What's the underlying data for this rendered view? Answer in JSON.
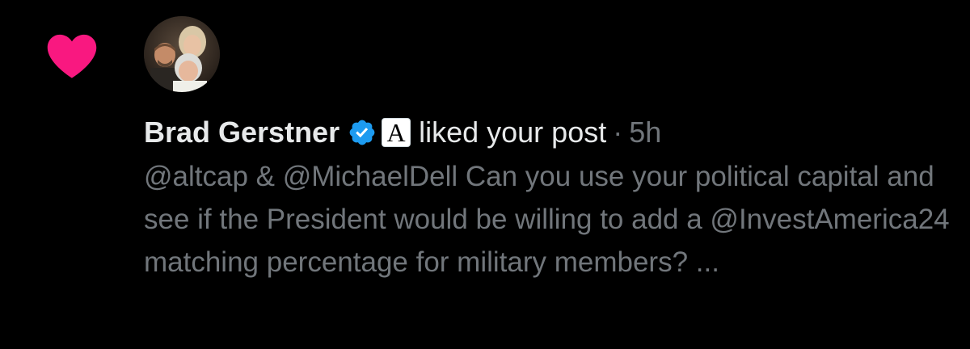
{
  "notification": {
    "type_icon": "heart-icon",
    "avatar_icon": "group-photo-avatar",
    "author": {
      "name": "Brad Gerstner",
      "verified_icon": "verified-badge-icon",
      "affiliate_label": "A"
    },
    "action": "liked your post",
    "separator": "·",
    "timestamp": "5h",
    "post_excerpt": "@altcap & @MichaelDell Can you use your political capital and see if the President would be willing to add a @InvestAmerica24 matching percentage for military members? ..."
  },
  "colors": {
    "background": "#000000",
    "heart": "#f91880",
    "primary_text": "#e7e9ea",
    "secondary_text": "#71767b",
    "verified": "#1d9bf0"
  }
}
